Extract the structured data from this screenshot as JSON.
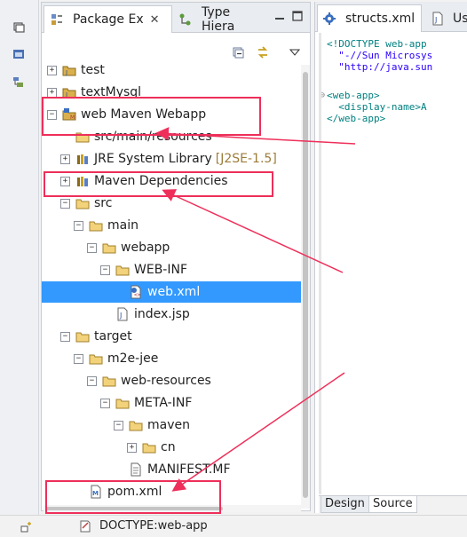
{
  "package_explorer": {
    "tab_label": "Package Ex",
    "tab_close": "✕",
    "other_tab_label": "Type Hiera",
    "tree": [
      {
        "label": "test",
        "decoration": "",
        "expander": "plus",
        "icon": "java-project-icon"
      },
      {
        "label": "textMysql",
        "decoration": "",
        "expander": "plus",
        "icon": "java-project-icon"
      },
      {
        "label": "web Maven Webapp",
        "decoration": "",
        "expander": "minus",
        "icon": "maven-project-icon"
      },
      {
        "label": "src/main/resources",
        "decoration": "",
        "expander": "none",
        "icon": "folder-icon"
      },
      {
        "label": "JRE System Library",
        "decoration": "[J2SE-1.5]",
        "expander": "plus",
        "icon": "library-icon"
      },
      {
        "label": "Maven Dependencies",
        "decoration": "",
        "expander": "plus",
        "icon": "library-icon"
      },
      {
        "label": "src",
        "decoration": "",
        "expander": "minus",
        "icon": "folder-icon"
      },
      {
        "label": "main",
        "decoration": "",
        "expander": "minus",
        "icon": "folder-icon"
      },
      {
        "label": "webapp",
        "decoration": "",
        "expander": "minus",
        "icon": "folder-icon"
      },
      {
        "label": "WEB-INF",
        "decoration": "",
        "expander": "minus",
        "icon": "folder-icon"
      },
      {
        "label": "web.xml",
        "decoration": "",
        "expander": "none",
        "icon": "xml-file-icon"
      },
      {
        "label": "index.jsp",
        "decoration": "",
        "expander": "none",
        "icon": "jsp-file-icon"
      },
      {
        "label": "target",
        "decoration": "",
        "expander": "minus",
        "icon": "folder-icon"
      },
      {
        "label": "m2e-jee",
        "decoration": "",
        "expander": "minus",
        "icon": "folder-icon"
      },
      {
        "label": "web-resources",
        "decoration": "",
        "expander": "minus",
        "icon": "folder-icon"
      },
      {
        "label": "META-INF",
        "decoration": "",
        "expander": "minus",
        "icon": "folder-icon"
      },
      {
        "label": "maven",
        "decoration": "",
        "expander": "minus",
        "icon": "folder-icon"
      },
      {
        "label": "cn",
        "decoration": "",
        "expander": "plus",
        "icon": "folder-icon"
      },
      {
        "label": "MANIFEST.MF",
        "decoration": "",
        "expander": "none",
        "icon": "text-file-icon"
      },
      {
        "label": "pom.xml",
        "decoration": "",
        "expander": "none",
        "icon": "maven-pom-icon"
      }
    ]
  },
  "editor": {
    "tab_label": "structs.xml",
    "other_tab_label": "Use",
    "code_lines": [
      "<!DOCTYPE web-app",
      "  \"-//Sun Microsys",
      "  \"http://java.sun",
      "",
      "<web-app>",
      "  <display-name>A",
      "</web-app>"
    ],
    "bottom_tabs": [
      "Design",
      "Source"
    ]
  },
  "status": {
    "breadcrumb": "DOCTYPE:web-app"
  },
  "colors": {
    "annotation": "#ee2f5a",
    "selection": "#3399ff"
  }
}
